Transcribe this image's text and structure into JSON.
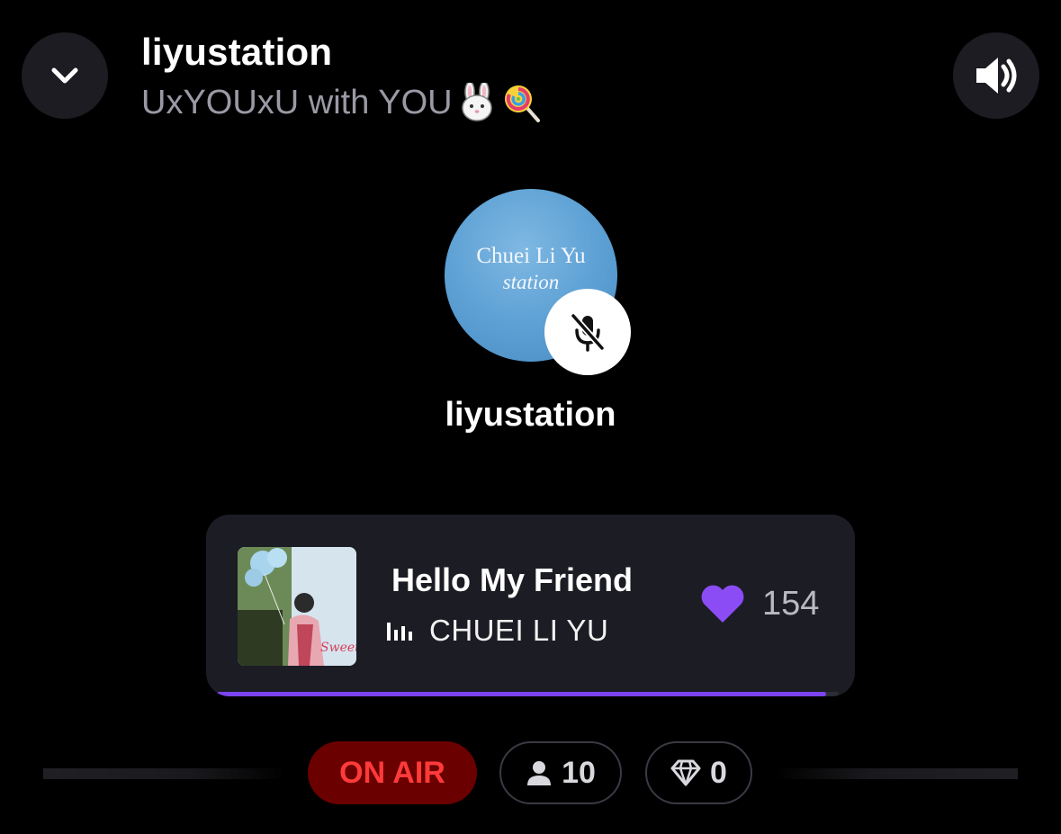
{
  "header": {
    "title": "liyustation",
    "subtitle": "UxYOUxU with YOU",
    "subtitle_emojis": [
      "rabbit-face-emoji",
      "lollipop-emoji"
    ]
  },
  "icons": {
    "collapse": "chevron-down-icon",
    "volume": "speaker-volume-icon",
    "mute": "microphone-muted-icon",
    "equalizer": "equalizer-bars-icon",
    "like": "heart-icon",
    "listeners": "person-icon",
    "gems": "diamond-icon"
  },
  "host": {
    "avatar_text_line1": "Chuei Li Yu",
    "avatar_text_line2": "station",
    "name": "liyustation",
    "muted": true
  },
  "now_playing": {
    "title": "Hello My Friend",
    "artist": "CHUEI LI YU",
    "likes": "154",
    "progress_fraction": 0.98,
    "cover_text": "Sweet"
  },
  "status": {
    "on_air_label": "ON AIR",
    "listeners": "10",
    "gems": "0"
  },
  "colors": {
    "background": "#000000",
    "accent_purple": "#7b44f0",
    "on_air_red": "#ff3a3a",
    "on_air_bg": "#6b0000",
    "card_bg": "#1c1c24"
  }
}
